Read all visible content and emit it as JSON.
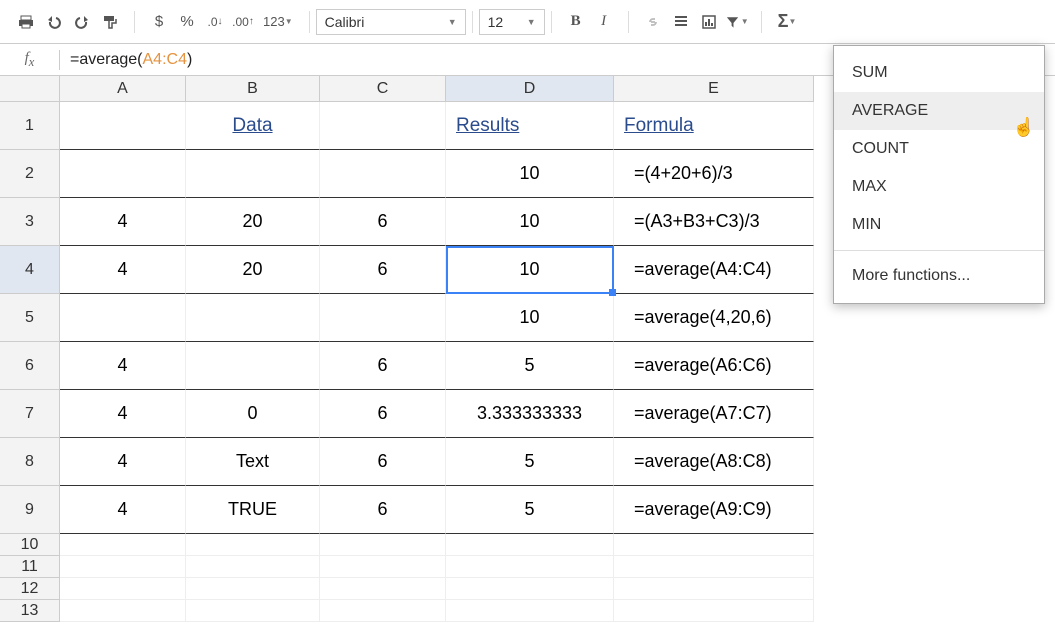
{
  "toolbar": {
    "font": "Calibri",
    "size": "12",
    "currency_label": "$",
    "percent_label": "%",
    "number_label": "123"
  },
  "formula_bar": {
    "prefix": "=average(",
    "range": "A4:C4",
    "suffix": ")"
  },
  "columns": [
    "A",
    "B",
    "C",
    "D",
    "E"
  ],
  "headers": {
    "data": "Data",
    "results": "Results",
    "formula": "Formula"
  },
  "rows": [
    {
      "A": "",
      "B": "",
      "C": "",
      "D": "10",
      "E": "=(4+20+6)/3"
    },
    {
      "A": "4",
      "B": "20",
      "C": "6",
      "D": "10",
      "E": "=(A3+B3+C3)/3"
    },
    {
      "A": "4",
      "B": "20",
      "C": "6",
      "D": "10",
      "E": "=average(A4:C4)"
    },
    {
      "A": "",
      "B": "",
      "C": "",
      "D": "10",
      "E": "=average(4,20,6)"
    },
    {
      "A": "4",
      "B": "",
      "C": "6",
      "D": "5",
      "E": "=average(A6:C6)"
    },
    {
      "A": "4",
      "B": "0",
      "C": "6",
      "D": "3.333333333",
      "E": "=average(A7:C7)"
    },
    {
      "A": "4",
      "B": "Text",
      "C": "6",
      "D": "5",
      "E": "=average(A8:C8)"
    },
    {
      "A": "4",
      "B": "TRUE",
      "C": "6",
      "D": "5",
      "E": "=average(A9:C9)"
    }
  ],
  "row_count_total": 13,
  "menu": {
    "items": [
      "SUM",
      "AVERAGE",
      "COUNT",
      "MAX",
      "MIN"
    ],
    "more": "More functions...",
    "hovered": "AVERAGE"
  },
  "selected_cell": "D4"
}
